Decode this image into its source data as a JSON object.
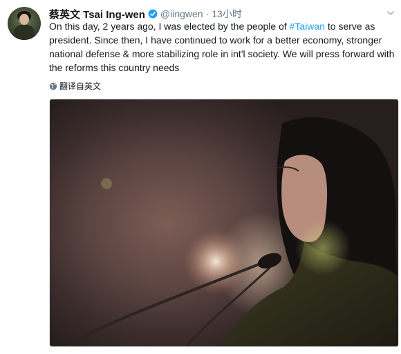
{
  "tweet": {
    "display_name": "蔡英文 Tsai Ing-wen",
    "handle": "@iingwen",
    "separator": "·",
    "timestamp": "13小时",
    "text_part1": "On this day, 2 years ago, I was elected by the people of ",
    "hashtag": "#Taiwan",
    "text_part2": " to serve as president. Since then, I have continued to work for a better economy, stronger national defense & more stabilizing role in int'l society. We will press forward with the reforms this country needs",
    "translate_label": "翻译自英文"
  },
  "icons": {
    "verified": "verified-badge-icon",
    "caret": "chevron-down-icon",
    "globe": "globe-icon"
  },
  "colors": {
    "link": "#1da1f2",
    "secondary_text": "#657786",
    "primary_text": "#14171a"
  }
}
